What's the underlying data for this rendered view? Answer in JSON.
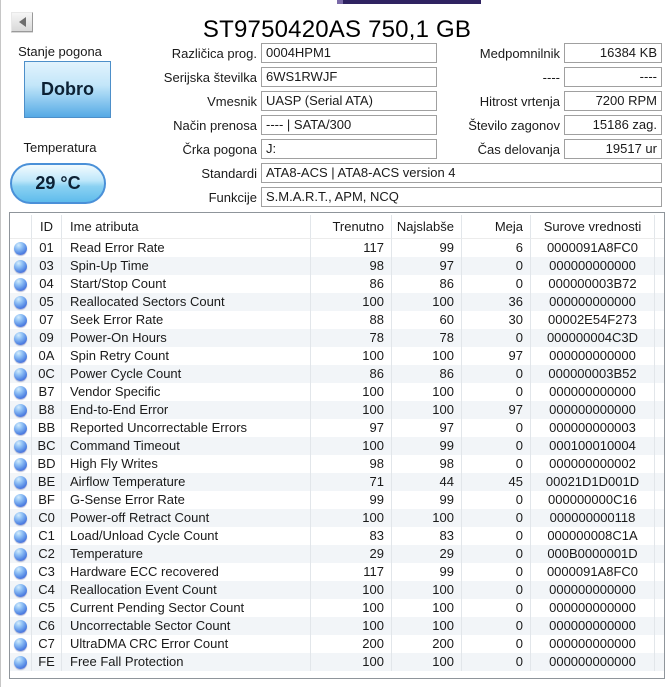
{
  "window": {
    "title": "ST9750420AS 750,1 GB"
  },
  "status": {
    "label": "Stanje pogona",
    "value": "Dobro"
  },
  "temperature": {
    "label": "Temperatura",
    "value": "29 °C"
  },
  "fields_mid": [
    {
      "label": "Različica prog.",
      "value": "0004HPM1"
    },
    {
      "label": "Serijska številka",
      "value": "6WS1RWJF"
    },
    {
      "label": "Vmesnik",
      "value": "UASP (Serial ATA)"
    },
    {
      "label": "Način prenosa",
      "value": "---- | SATA/300"
    },
    {
      "label": "Črka pogona",
      "value": "J:"
    }
  ],
  "fields_right": [
    {
      "label": "Medpomnilnik",
      "value": "16384 KB"
    },
    {
      "label": "----",
      "value": "----"
    },
    {
      "label": "Hitrost vrtenja",
      "value": "7200 RPM"
    },
    {
      "label": "Število zagonov",
      "value": "15186 zag."
    },
    {
      "label": "Čas delovanja",
      "value": "19517 ur"
    }
  ],
  "fields_wide": [
    {
      "label": "Standardi",
      "value": "ATA8-ACS | ATA8-ACS version 4"
    },
    {
      "label": "Funkcije",
      "value": "S.M.A.R.T., APM, NCQ"
    }
  ],
  "table": {
    "headers": [
      "ID",
      "Ime atributa",
      "Trenutno",
      "Najslabše",
      "Meja",
      "Surove vrednosti"
    ],
    "rows": [
      [
        "01",
        "Read Error Rate",
        "117",
        "99",
        "6",
        "0000091A8FC0"
      ],
      [
        "03",
        "Spin-Up Time",
        "98",
        "97",
        "0",
        "000000000000"
      ],
      [
        "04",
        "Start/Stop Count",
        "86",
        "86",
        "0",
        "000000003B72"
      ],
      [
        "05",
        "Reallocated Sectors Count",
        "100",
        "100",
        "36",
        "000000000000"
      ],
      [
        "07",
        "Seek Error Rate",
        "88",
        "60",
        "30",
        "00002E54F273"
      ],
      [
        "09",
        "Power-On Hours",
        "78",
        "78",
        "0",
        "000000004C3D"
      ],
      [
        "0A",
        "Spin Retry Count",
        "100",
        "100",
        "97",
        "000000000000"
      ],
      [
        "0C",
        "Power Cycle Count",
        "86",
        "86",
        "0",
        "000000003B52"
      ],
      [
        "B7",
        "Vendor Specific",
        "100",
        "100",
        "0",
        "000000000000"
      ],
      [
        "B8",
        "End-to-End Error",
        "100",
        "100",
        "97",
        "000000000000"
      ],
      [
        "BB",
        "Reported Uncorrectable Errors",
        "97",
        "97",
        "0",
        "000000000003"
      ],
      [
        "BC",
        "Command Timeout",
        "100",
        "99",
        "0",
        "000100010004"
      ],
      [
        "BD",
        "High Fly Writes",
        "98",
        "98",
        "0",
        "000000000002"
      ],
      [
        "BE",
        "Airflow Temperature",
        "71",
        "44",
        "45",
        "00021D1D001D"
      ],
      [
        "BF",
        "G-Sense Error Rate",
        "99",
        "99",
        "0",
        "000000000C16"
      ],
      [
        "C0",
        "Power-off Retract Count",
        "100",
        "100",
        "0",
        "000000000118"
      ],
      [
        "C1",
        "Load/Unload Cycle Count",
        "83",
        "83",
        "0",
        "000000008C1A"
      ],
      [
        "C2",
        "Temperature",
        "29",
        "29",
        "0",
        "000B0000001D"
      ],
      [
        "C3",
        "Hardware ECC recovered",
        "117",
        "99",
        "0",
        "0000091A8FC0"
      ],
      [
        "C4",
        "Reallocation Event Count",
        "100",
        "100",
        "0",
        "000000000000"
      ],
      [
        "C5",
        "Current Pending Sector Count",
        "100",
        "100",
        "0",
        "000000000000"
      ],
      [
        "C6",
        "Uncorrectable Sector Count",
        "100",
        "100",
        "0",
        "000000000000"
      ],
      [
        "C7",
        "UltraDMA CRC Error Count",
        "200",
        "200",
        "0",
        "000000000000"
      ],
      [
        "FE",
        "Free Fall Protection",
        "100",
        "100",
        "0",
        "000000000000"
      ]
    ]
  },
  "colors": {
    "status_good_blue": "#55a9e5",
    "temperature_badge_blue": "#5fbcec",
    "orb_blue": "#4f82e2",
    "panel_border": "#8f959b"
  }
}
